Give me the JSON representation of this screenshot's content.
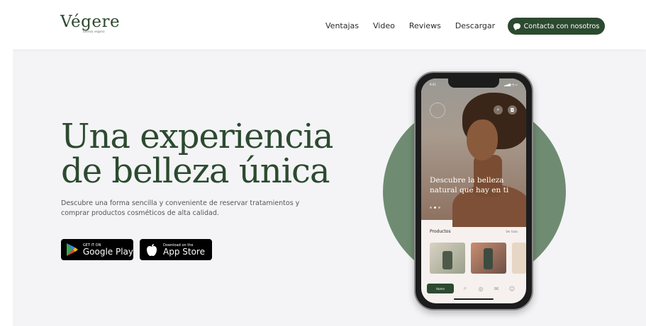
{
  "nav": {
    "logo": "Végere",
    "logo_sub": "Belleza vegana",
    "links": [
      "Ventajas",
      "Video",
      "Reviews",
      "Descargar"
    ],
    "contact_label": "Contacta con nosotros"
  },
  "hero": {
    "title_line1": "Una experiencia",
    "title_line2": "de belleza única",
    "subtitle": "Descubre una forma sencilla y conveniente de reservar tratamientos y comprar productos cosméticos de alta calidad."
  },
  "badges": {
    "google_small": "GET IT ON",
    "google_big": "Google Play",
    "apple_small": "Download on the",
    "apple_big": "App Store"
  },
  "phone": {
    "status_time": "9:41",
    "status_icons": "▂▄▆ ◔ ▭",
    "caption": "Descubre la belleza natural que hay en ti",
    "products_title": "Productos",
    "products_link": "Ver todo",
    "tab_home": "Home"
  },
  "colors": {
    "brand_green": "#2c4a2f",
    "circle_green": "#6f8c72",
    "background": "#f4f4f6"
  }
}
